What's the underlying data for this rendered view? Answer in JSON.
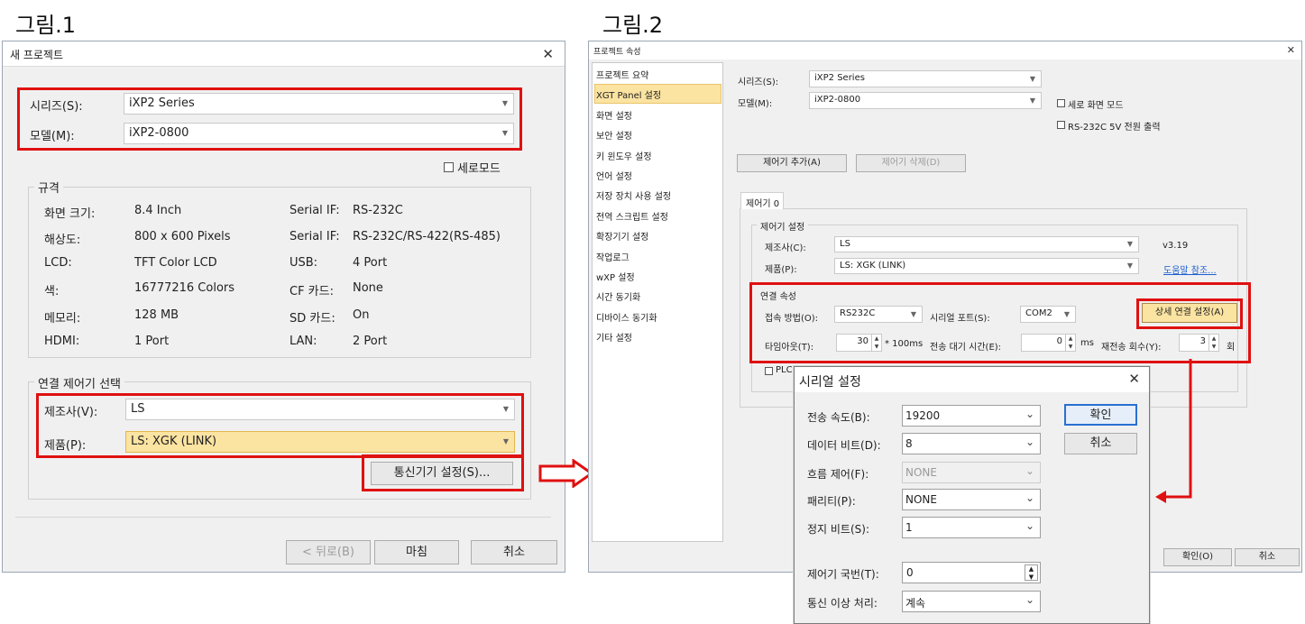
{
  "captions": {
    "fig1": "그림.1",
    "fig2": "그림.2"
  },
  "dialog1": {
    "title": "새 프로젝트",
    "close": "✕",
    "series_label": "시리즈(S):",
    "series_value": "iXP2 Series",
    "model_label": "모델(M):",
    "model_value": "iXP2-0800",
    "vertical_mode": "세로모드",
    "spec_title": "규격",
    "specs_left": [
      {
        "k": "화면 크기:",
        "v": "8.4 Inch"
      },
      {
        "k": "해상도:",
        "v": "800 x 600 Pixels"
      },
      {
        "k": "LCD:",
        "v": "TFT Color LCD"
      },
      {
        "k": "색:",
        "v": "16777216 Colors"
      },
      {
        "k": "메모리:",
        "v": "128 MB"
      },
      {
        "k": "HDMI:",
        "v": "1 Port"
      }
    ],
    "specs_right": [
      {
        "k": "Serial IF:",
        "v": "RS-232C"
      },
      {
        "k": "Serial IF:",
        "v": "RS-232C/RS-422(RS-485)"
      },
      {
        "k": "USB:",
        "v": "4 Port"
      },
      {
        "k": "CF 카드:",
        "v": "None"
      },
      {
        "k": "SD 카드:",
        "v": "On"
      },
      {
        "k": "LAN:",
        "v": "2 Port"
      }
    ],
    "conn_title": "연결 제어기 선택",
    "maker_label": "제조사(V):",
    "maker_value": "LS",
    "product_label": "제품(P):",
    "product_value": "LS: XGK (LINK)",
    "comm_button": "통신기기 설정(S)...",
    "back_button": "< 뒤로(B)",
    "finish_button": "마침",
    "cancel_button": "취소"
  },
  "dialog2": {
    "title": "프로젝트 속성",
    "close": "✕",
    "sidebar": [
      "프로젝트 요약",
      "XGT Panel 설정",
      "화면 설정",
      "보안 설정",
      "키 윈도우 설정",
      "언어 설정",
      "저장 장치 사용 설정",
      "전역 스크립트 설정",
      "확장기기 설정",
      "작업로그",
      "wXP 설정",
      "시간 동기화",
      "디바이스 동기화",
      "기타 설정"
    ],
    "series_label": "시리즈(S):",
    "series_value": "iXP2 Series",
    "model_label": "모델(M):",
    "model_value": "iXP2-0800",
    "vertical_mode": "세로 화면 모드",
    "rs232_power": "RS-232C 5V 전원 출력",
    "add_ctrl": "제어기 추가(A)",
    "del_ctrl": "제어기 삭제(D)",
    "tab": "제어기 0",
    "ctrl_group": "제어기 설정",
    "maker_label": "제조사(C):",
    "maker_value": "LS",
    "version": "v3.19",
    "product_label": "제품(P):",
    "product_value": "LS: XGK (LINK)",
    "help_link": "도움말 참조...",
    "conn_group": "연결 속성",
    "method_label": "접속 방법(O):",
    "method_value": "RS232C",
    "port_label": "시리얼 포트(S):",
    "port_value": "COM2",
    "detail_button": "상세 연결 설정(A)",
    "timeout_label": "타임아웃(T):",
    "timeout_value": "30",
    "timeout_unit": "* 100ms",
    "wait_label": "전송 대기 시간(E):",
    "wait_value": "0",
    "wait_unit": "ms",
    "retry_label": "재전송 회수(Y):",
    "retry_value": "3",
    "retry_unit": "회",
    "plc_label": "PLC",
    "ok_button": "확인(O)",
    "cancel_button": "취소"
  },
  "serial_dialog": {
    "title": "시리얼 설정",
    "close": "✕",
    "fields": [
      {
        "label": "전송 속도(B):",
        "value": "19200",
        "disabled": false
      },
      {
        "label": "데이터 비트(D):",
        "value": "8",
        "disabled": false
      },
      {
        "label": "흐름 제어(F):",
        "value": "NONE",
        "disabled": true
      },
      {
        "label": "패리티(P):",
        "value": "NONE",
        "disabled": false
      },
      {
        "label": "정지 비트(S):",
        "value": "1",
        "disabled": false
      }
    ],
    "station_label": "제어기 국번(T):",
    "station_value": "0",
    "error_label": "통신 이상 처리:",
    "error_value": "계속",
    "ok_button": "확인",
    "cancel_button": "취소"
  },
  "colors": {
    "highlight_red": "#e01010",
    "selected_bg": "#fbe3a1",
    "link": "#1e5fd0"
  }
}
